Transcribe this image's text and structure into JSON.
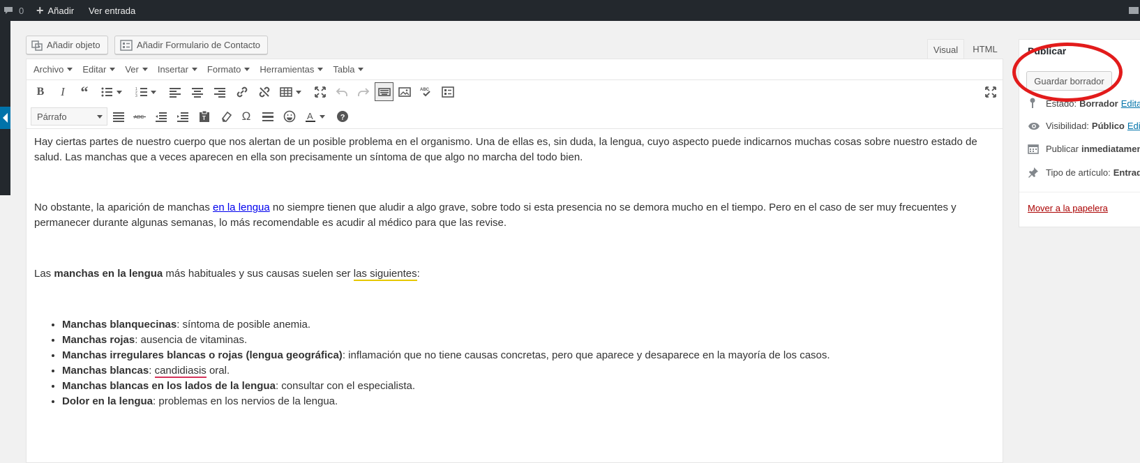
{
  "adminbar": {
    "comments_count": "0",
    "add_label": "Añadir",
    "view_label": "Ver entrada"
  },
  "media": {
    "add_object": "Añadir objeto",
    "add_contact_form": "Añadir Formulario de Contacto"
  },
  "tabs": {
    "visual": "Visual",
    "html": "HTML"
  },
  "menubar": [
    "Archivo",
    "Editar",
    "Ver",
    "Insertar",
    "Formato",
    "Herramientas",
    "Tabla"
  ],
  "toolbar": {
    "format_select": "Párrafo",
    "row1_icons": [
      "bold-icon",
      "italic-icon",
      "blockquote-icon",
      "bullet-list-icon",
      "numbered-list-icon",
      "align-left-icon",
      "align-center-icon",
      "align-right-icon",
      "link-icon",
      "unlink-icon",
      "table-icon",
      "fullscreen-icon",
      "undo-icon",
      "redo-icon",
      "keyboard-icon",
      "image-icon",
      "spellcheck-icon",
      "form-icon"
    ],
    "row2_icons": [
      "justify-icon",
      "strikethrough-icon",
      "outdent-icon",
      "indent-icon",
      "paste-text-icon",
      "clear-format-icon",
      "omega-icon",
      "hr-icon",
      "emoji-icon",
      "text-color-icon",
      "help-icon"
    ]
  },
  "content": {
    "p1": "Hay ciertas partes de nuestro cuerpo que nos alertan de un posible problema en el organismo. Una de ellas es, sin duda, la lengua, cuyo aspecto puede indicarnos muchas cosas sobre nuestro estado de salud. Las manchas que a veces aparecen en ella son precisamente un síntoma de que algo no marcha del todo bien.",
    "p2_before": "No obstante, la aparición de manchas ",
    "p2_link": "en la lengua",
    "p2_after": " no siempre tienen que aludir a algo grave, sobre todo si esta presencia no se demora mucho en el tiempo. Pero en el caso de ser muy frecuentes y permanecer durante algunas semanas, lo más recomendable es acudir al médico para que las revise.",
    "p3_before": "Las ",
    "p3_bold": "manchas en la lengua",
    "p3_mid": " más habituales y sus causas suelen ser ",
    "p3_underlined": "las siguientes",
    "p3_after": ":",
    "list": [
      {
        "bold": "Manchas blanquecinas",
        "text": ": síntoma de posible anemia."
      },
      {
        "bold": "Manchas rojas",
        "text": ": ausencia de vitaminas."
      },
      {
        "bold": "Manchas irregulares blancas o rojas (lengua geográfica)",
        "text": ": inflamación que no tiene causas concretas, pero que aparece y desaparece en la mayoría de los casos."
      },
      {
        "bold": "Manchas blancas",
        "text_before": ": ",
        "misspelled": "candidiasis",
        "text": " oral."
      },
      {
        "bold": "Manchas blancas en los lados de la lengua",
        "text": ": consultar con el especialista."
      },
      {
        "bold": "Dolor en la lengua",
        "text": ": problemas en los nervios de la lengua."
      }
    ]
  },
  "publish": {
    "title": "Publicar",
    "save_draft": "Guardar borrador",
    "status_label": "Estado:",
    "status_value": "Borrador",
    "status_edit": "Editar",
    "visibility_label": "Visibilidad:",
    "visibility_value": "Público",
    "visibility_edit": "Editar",
    "publish_label": "Publicar",
    "publish_value": "inmediatamente",
    "type_label": "Tipo de artículo:",
    "type_value": "Entrada",
    "trash": "Mover a la papelera"
  },
  "colors": {
    "adminbar": "#23282d",
    "accent": "#0073aa",
    "annotation_circle": "#e21b1b",
    "trash": "#aa0000"
  }
}
